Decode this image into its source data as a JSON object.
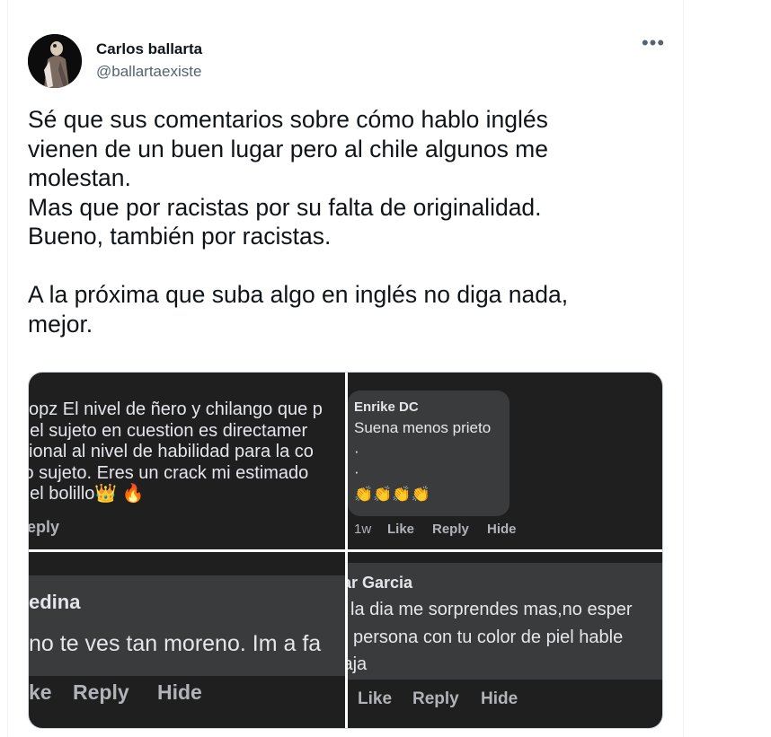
{
  "author": {
    "name": "Carlos ballarta",
    "handle": "@ballartaexiste"
  },
  "more_icon": "more-horizontal-icon",
  "tweet": {
    "text": "Sé que sus comentarios sobre cómo hablo inglés\nvienen de un buen lugar pero al chile algunos me\nmolestan.\nMas que por racistas por su falta de originalidad.\nBueno, también por racistas.\n\nA la próxima que suba algo en inglés no diga nada,\nmejor."
  },
  "media": {
    "panel1": {
      "lines": [
        "kopz El nivel de ñero y chilango que p",
        "del sujeto en cuestion es directamer",
        "cional al nivel de habilidad para la co",
        "io sujeto. Eres un crack mi estimado",
        "del bolillo👑 🔥"
      ],
      "reply": "eply"
    },
    "panel2": {
      "name": "Enrike DC",
      "line1": "Suena menos prieto",
      "dot1": "·",
      "dot2": "·",
      "emoji": "👏👏👏👏",
      "time": "1w",
      "like": "Like",
      "reply": "Reply",
      "hide": "Hide"
    },
    "panel3": {
      "name": "edina",
      "line": "no te ves tan moreno. Im a fa",
      "like": "ke",
      "reply": "Reply",
      "hide": "Hide"
    },
    "panel4": {
      "name": "ar Garcia",
      "line1": "la dia me sorprendes mas,no esper",
      "line2": "persona con tu color de piel hable",
      "line3": "jaja",
      "like": "Like",
      "reply": "Reply",
      "hide": "Hide"
    }
  },
  "colors": {
    "panel_bg": "#1f1f20",
    "bubble_bg": "#3a3b3c",
    "secondary_text": "#536471",
    "action_text": "#b0b3b8"
  }
}
